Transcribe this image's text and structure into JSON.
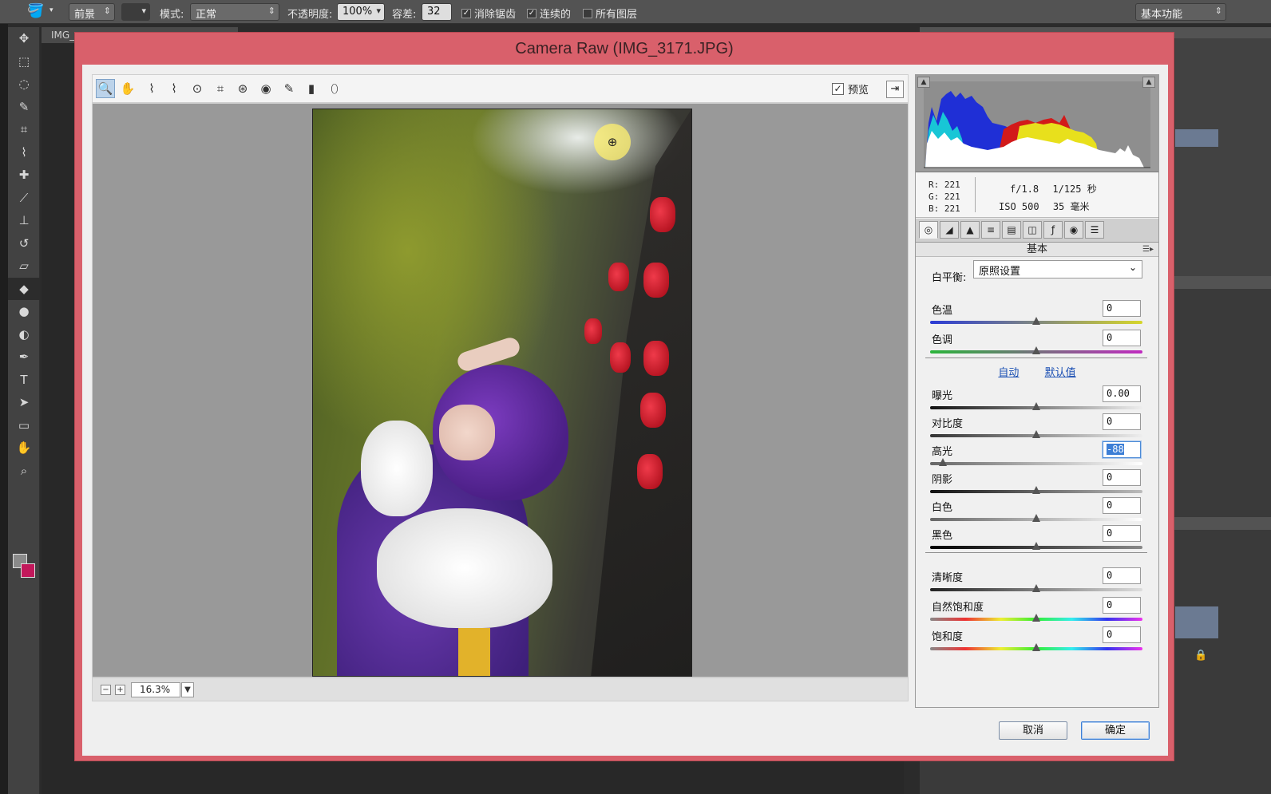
{
  "ps": {
    "optbar": {
      "fill_label": "前景",
      "mode_label": "模式:",
      "mode_value": "正常",
      "opacity_label": "不透明度:",
      "opacity_value": "100%",
      "tolerance_label": "容差:",
      "tolerance_value": "32",
      "antialias_label": "消除锯齿",
      "contiguous_label": "连续的",
      "all_layers_label": "所有图层",
      "workspace_value": "基本功能"
    },
    "doc_tab": "IMG_"
  },
  "dialog": {
    "title": "Camera Raw (IMG_3171.JPG)",
    "preview_label": "预览",
    "zoom_value": "16.3%",
    "histogram": {
      "r": "R:  221",
      "g": "G:  221",
      "b": "B:  221",
      "aperture": "f/1.8",
      "shutter": "1/125 秒",
      "iso": "ISO 500",
      "focal": "35 毫米"
    },
    "panel_title": "基本",
    "white_balance": {
      "label": "白平衡:",
      "value": "原照设置"
    },
    "links": {
      "auto": "自动",
      "default": "默认值"
    },
    "controls": [
      {
        "label": "色温",
        "value": "0",
        "level": 0.5
      },
      {
        "label": "色调",
        "value": "0",
        "level": 0.5
      },
      {
        "label": "曝光",
        "value": "0.00",
        "level": 0.5
      },
      {
        "label": "对比度",
        "value": "0",
        "level": 0.5
      },
      {
        "label": "高光",
        "value": "-88",
        "level": 0.06
      },
      {
        "label": "阴影",
        "value": "0",
        "level": 0.5
      },
      {
        "label": "白色",
        "value": "0",
        "level": 0.5
      },
      {
        "label": "黑色",
        "value": "0",
        "level": 0.5
      },
      {
        "label": "清晰度",
        "value": "0",
        "level": 0.5
      },
      {
        "label": "自然饱和度",
        "value": "0",
        "level": 0.5
      },
      {
        "label": "饱和度",
        "value": "0",
        "level": 0.5
      }
    ],
    "cancel_label": "取消",
    "ok_label": "确定"
  },
  "colors": {
    "dialog_frame": "#d9606b",
    "selection_blue": "#3d7fd6",
    "link_blue": "#1a4fb3"
  },
  "icons": {
    "toolbar": [
      "zoom-icon",
      "hand-icon",
      "white-balance-icon",
      "color-sampler-icon",
      "target-adjust-icon",
      "crop-icon",
      "straighten-icon",
      "spot-removal-icon",
      "red-eye-icon",
      "adjustment-brush-icon",
      "graduated-filter-icon",
      "radial-filter-icon"
    ],
    "tabs": [
      "basic-tab-icon",
      "tone-curve-tab-icon",
      "detail-tab-icon",
      "hsl-tab-icon",
      "split-toning-tab-icon",
      "lens-tab-icon",
      "effects-tab-icon",
      "camera-calibration-tab-icon",
      "presets-tab-icon"
    ]
  }
}
